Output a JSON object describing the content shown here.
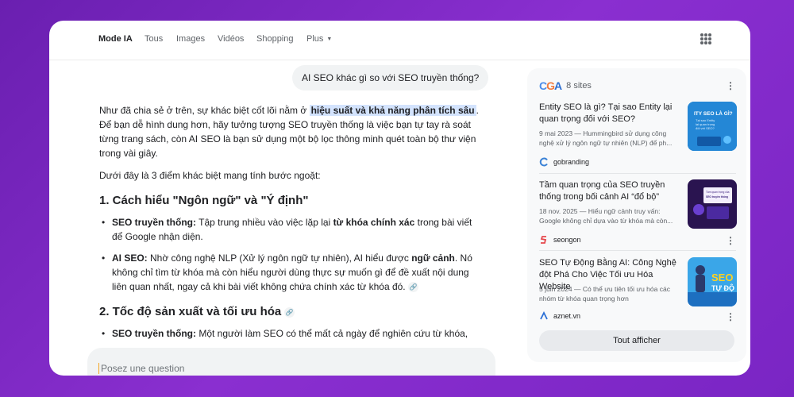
{
  "nav": {
    "tabs": [
      {
        "label": "Mode IA",
        "active": true
      },
      {
        "label": "Tous"
      },
      {
        "label": "Images"
      },
      {
        "label": "Vidéos"
      },
      {
        "label": "Shopping"
      },
      {
        "label": "Plus"
      }
    ],
    "apps_icon": "apps-grid-icon"
  },
  "chat": {
    "user_question": "AI SEO khác gì so với SEO truyền thống?",
    "intro_before": "Như đã chia sẻ ở trên, sự khác biệt cốt lõi nằm ở ",
    "intro_highlight": "hiệu suất và khả năng phân tích sâu",
    "intro_after": ". Để bạn dễ hình dung hơn, hãy tưởng tượng SEO truyền thống là việc bạn tự tay rà soát từng trang sách, còn AI SEO là bạn sử dụng một bộ lọc thông minh quét toàn bộ thư viện trong vài giây.",
    "lead": "Dưới đây là 3 điểm khác biệt mang tính bước ngoặt:",
    "section1_title": "1. Cách hiểu \"Ngôn ngữ\" và \"Ý định\"",
    "s1b1_label": "SEO truyền thống:",
    "s1b1_a": " Tập trung nhiều vào việc lặp lại ",
    "s1b1_bold": "từ khóa chính xác",
    "s1b1_b": " trong bài viết để Google nhận diện.",
    "s1b2_label": "AI SEO:",
    "s1b2_a": " Nhờ công nghệ NLP (Xử lý ngôn ngữ tự nhiên), AI hiểu được ",
    "s1b2_bold": "ngữ cảnh",
    "s1b2_b": ". Nó không chỉ tìm từ khóa mà còn hiểu người dùng thực sự muốn gì để đề xuất nội dung liên quan nhất, ngay cả khi bài viết không chứa chính xác từ khóa đó.",
    "section2_title": "2. Tốc độ sản xuất và tối ưu hóa",
    "s2b1_label": "SEO truyền thống:",
    "s2b1_text": " Một người làm SEO có thể mất cả ngày để nghiên cứu từ khóa,",
    "ask_placeholder": "Posez une question",
    "link_icon": "link-icon"
  },
  "sources": {
    "count_label": "8 sites",
    "items": [
      {
        "title": "Entity SEO là gì? Tại sao Entity lại quan trọng đối với SEO?",
        "snippet": "9 mai 2023 — Hummingbird sử dụng công nghệ xử lý ngôn ngữ tự nhiên (NLP) để ph...",
        "site": "gobranding",
        "thumb_lines": [
          "ITY SEO LÀ GÌ?",
          "Tại sao Entity",
          "lại quan trọng",
          "đối với SEO?"
        ]
      },
      {
        "title": "Tầm quan trọng của SEO truyền thống trong bối cảnh AI “đổ bộ”",
        "snippet": "18 nov. 2025 — Hiểu ngữ cảnh truy vấn: Google không chỉ dựa vào từ khóa mà còn...",
        "site": "seongon",
        "thumb_lines": [
          "Tầm quan trọng của",
          "SEO truyền thống"
        ]
      },
      {
        "title": "SEO Tự Động Bằng AI: Công Nghệ đột Phá Cho Việc Tối ưu Hóa Website",
        "snippet": "5 juin 2024 — Có thể ưu tiên tối ưu hóa các nhóm từ khóa quan trọng hơn",
        "site": "aznet.vn",
        "thumb_lines": [
          "SEO",
          "TỰ ĐỘ"
        ]
      }
    ],
    "show_all": "Tout afficher"
  },
  "colors": {
    "background": "#7a25c4",
    "highlight": "#d3e3fd",
    "text": "#202124",
    "muted": "#5f6368"
  }
}
